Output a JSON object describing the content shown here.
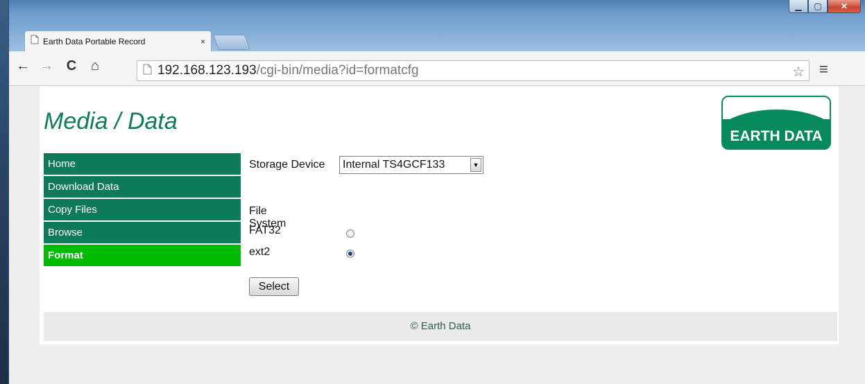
{
  "browser": {
    "tab_title": "Earth Data Portable Record",
    "tab_close": "×",
    "url_host": "192.168.123.193",
    "url_path": "/cgi-bin/media?id=formatcfg",
    "window_controls": {
      "minimize": "▁",
      "maximize": "▢",
      "close": "✕"
    },
    "nav": {
      "back": "←",
      "forward": "→",
      "reload": "C",
      "home": "⌂"
    },
    "star": "☆",
    "menu": "≡"
  },
  "page": {
    "title": "Media / Data",
    "logo_text": "EARTH DATA",
    "colors": {
      "nav": "#0f7a5b",
      "nav_active": "#00bb00",
      "title": "#117a5e",
      "logo": "#078a59"
    }
  },
  "sidebar": {
    "items": [
      {
        "label": "Home",
        "active": false
      },
      {
        "label": "Download Data",
        "active": false
      },
      {
        "label": "Copy Files",
        "active": false
      },
      {
        "label": "Browse",
        "active": false
      },
      {
        "label": "Format",
        "active": true
      }
    ]
  },
  "form": {
    "storage_label": "Storage Device",
    "storage_value": "Internal TS4GCF133",
    "filesystem_label": "File System",
    "options": [
      {
        "label": "FAT32",
        "checked": false
      },
      {
        "label": "ext2",
        "checked": true
      }
    ],
    "submit_label": "Select"
  },
  "footer": {
    "text": "© Earth Data"
  },
  "icons": [
    "page-icon",
    "back-icon",
    "forward-icon",
    "reload-icon",
    "home-icon",
    "star-icon",
    "menu-icon",
    "dropdown-arrow-icon"
  ]
}
